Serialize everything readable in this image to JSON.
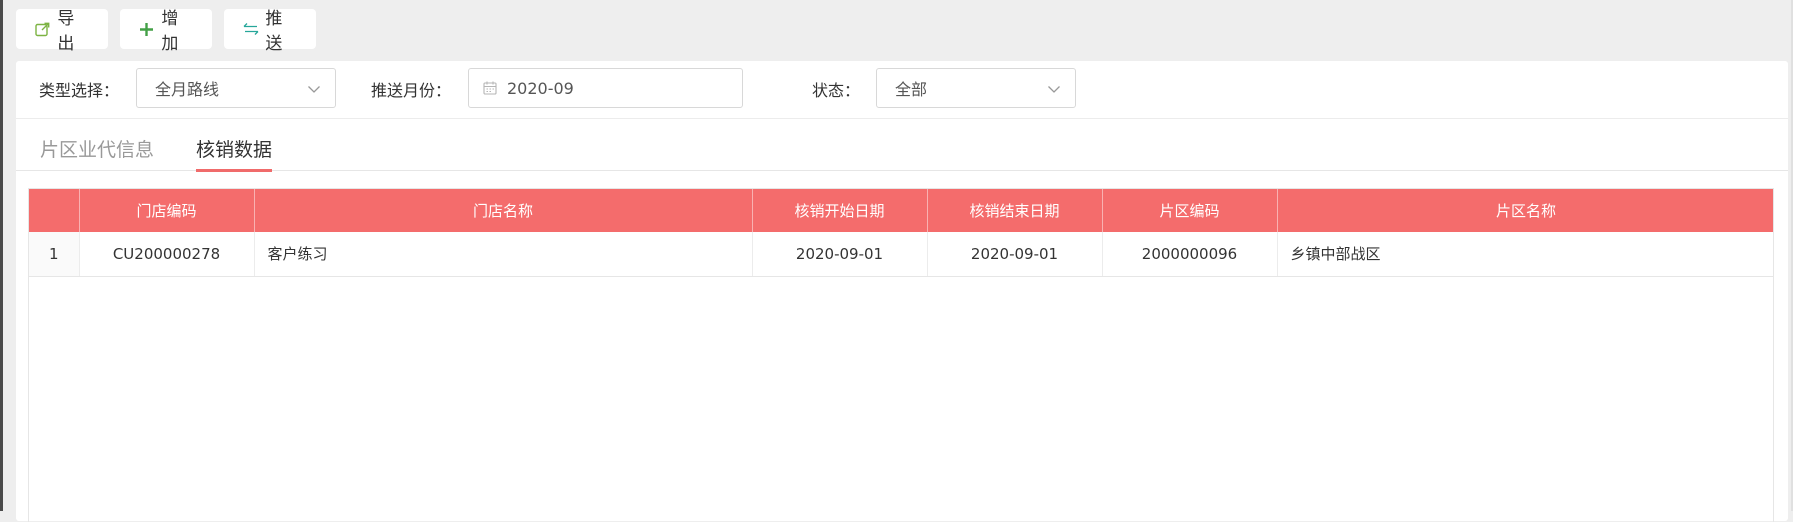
{
  "toolbar": {
    "export_label": "导出",
    "add_label": "增加",
    "push_label": "推送",
    "icon_color_export": "#7cb342",
    "icon_color_add": "#43a047",
    "icon_color_push": "#26a69a"
  },
  "filters": {
    "type_label": "类型选择：",
    "type_value": "全月路线",
    "month_label": "推送月份：",
    "month_value": "2020-09",
    "status_label": "状态：",
    "status_value": "全部"
  },
  "tabs": [
    {
      "label": "片区业代信息",
      "active": false
    },
    {
      "label": "核销数据",
      "active": true
    }
  ],
  "table": {
    "headers": [
      "",
      "门店编码",
      "门店名称",
      "核销开始日期",
      "核销结束日期",
      "片区编码",
      "片区名称"
    ],
    "rows": [
      [
        "1",
        "CU200000278",
        "客户练习",
        "2020-09-01",
        "2020-09-01",
        "2000000096",
        "乡镇中部战区"
      ]
    ],
    "header_color": "#f46c6c"
  }
}
